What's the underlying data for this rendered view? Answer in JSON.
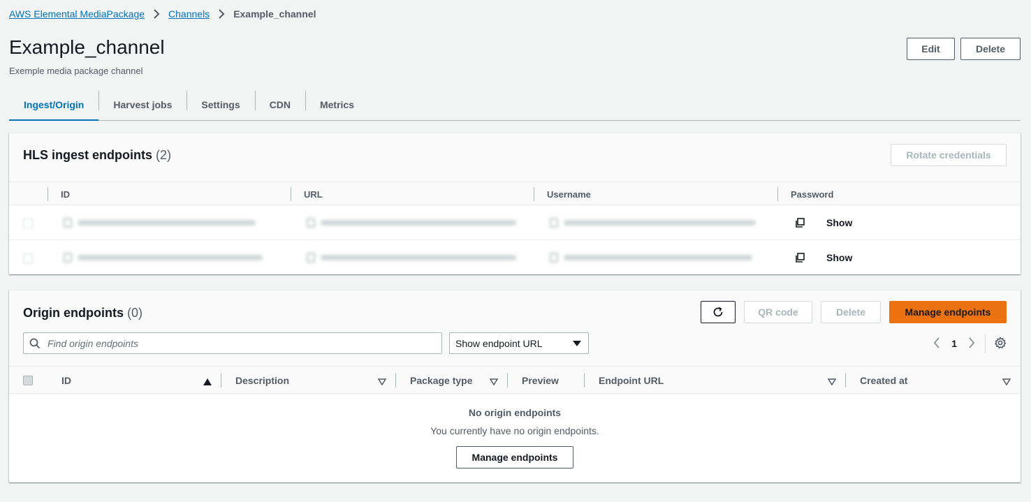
{
  "breadcrumb": {
    "items": [
      "AWS Elemental MediaPackage",
      "Channels"
    ],
    "current": "Example_channel"
  },
  "page": {
    "title": "Example_channel",
    "subtitle": "Exemple media package channel",
    "edit_label": "Edit",
    "delete_label": "Delete"
  },
  "tabs": [
    "Ingest/Origin",
    "Harvest jobs",
    "Settings",
    "CDN",
    "Metrics"
  ],
  "active_tab": "Ingest/Origin",
  "hls": {
    "title": "HLS ingest endpoints",
    "count": "(2)",
    "rotate_label": "Rotate credentials",
    "columns": [
      "ID",
      "URL",
      "Username",
      "Password"
    ],
    "rows": [
      {
        "password_action": "Show"
      },
      {
        "password_action": "Show"
      }
    ]
  },
  "origin": {
    "title": "Origin endpoints",
    "count": "(0)",
    "qr_label": "QR code",
    "delete_label": "Delete",
    "manage_label": "Manage endpoints",
    "search_placeholder": "Find origin endpoints",
    "select_value": "Show endpoint URL",
    "page_number": "1",
    "columns": [
      "ID",
      "Description",
      "Package type",
      "Preview",
      "Endpoint URL",
      "Created at"
    ],
    "empty_title": "No origin endpoints",
    "empty_desc": "You currently have no origin endpoints.",
    "empty_button": "Manage endpoints"
  },
  "colors": {
    "link": "#0073bb",
    "primary": "#ec7211",
    "background": "#f2f3f3"
  }
}
